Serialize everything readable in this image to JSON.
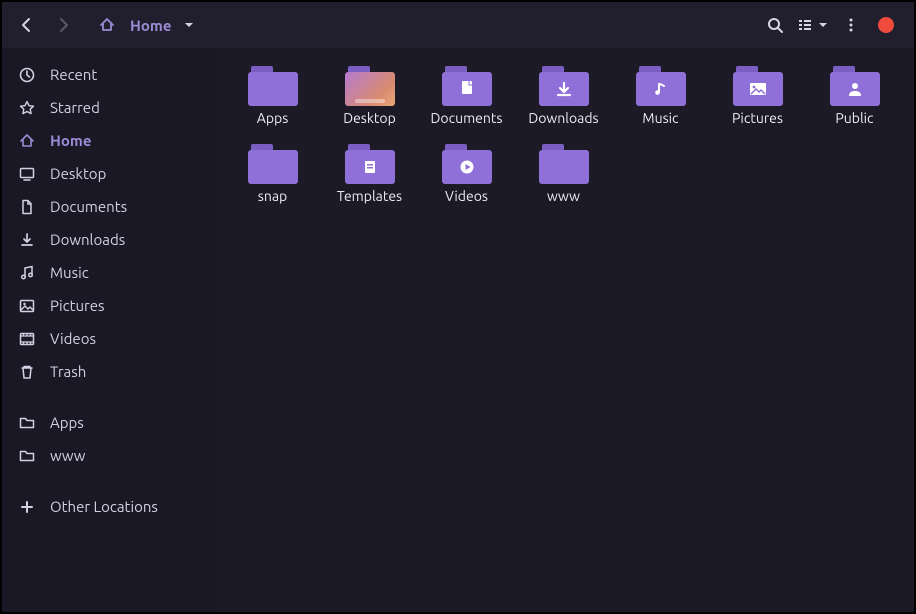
{
  "toolbar": {
    "path": "Home"
  },
  "sidebar": [
    {
      "icon": "clock",
      "label": "Recent"
    },
    {
      "icon": "star",
      "label": "Starred"
    },
    {
      "icon": "home",
      "label": "Home",
      "active": true
    },
    {
      "icon": "desktop",
      "label": "Desktop"
    },
    {
      "icon": "doc",
      "label": "Documents"
    },
    {
      "icon": "download",
      "label": "Downloads"
    },
    {
      "icon": "music",
      "label": "Music"
    },
    {
      "icon": "picture",
      "label": "Pictures"
    },
    {
      "icon": "video",
      "label": "Videos"
    },
    {
      "icon": "trash",
      "label": "Trash"
    },
    {
      "sep": true
    },
    {
      "icon": "folder",
      "label": "Apps"
    },
    {
      "icon": "folder",
      "label": "www"
    },
    {
      "sep": true
    },
    {
      "icon": "plus",
      "label": "Other Locations"
    }
  ],
  "items": [
    {
      "label": "Apps",
      "glyph": ""
    },
    {
      "label": "Desktop",
      "glyph": "",
      "variant": "desktop"
    },
    {
      "label": "Documents",
      "glyph": "doc"
    },
    {
      "label": "Downloads",
      "glyph": "download"
    },
    {
      "label": "Music",
      "glyph": "music"
    },
    {
      "label": "Pictures",
      "glyph": "picture"
    },
    {
      "label": "Public",
      "glyph": "public"
    },
    {
      "label": "snap",
      "glyph": ""
    },
    {
      "label": "Templates",
      "glyph": "template"
    },
    {
      "label": "Videos",
      "glyph": "play"
    },
    {
      "label": "www",
      "glyph": ""
    }
  ]
}
